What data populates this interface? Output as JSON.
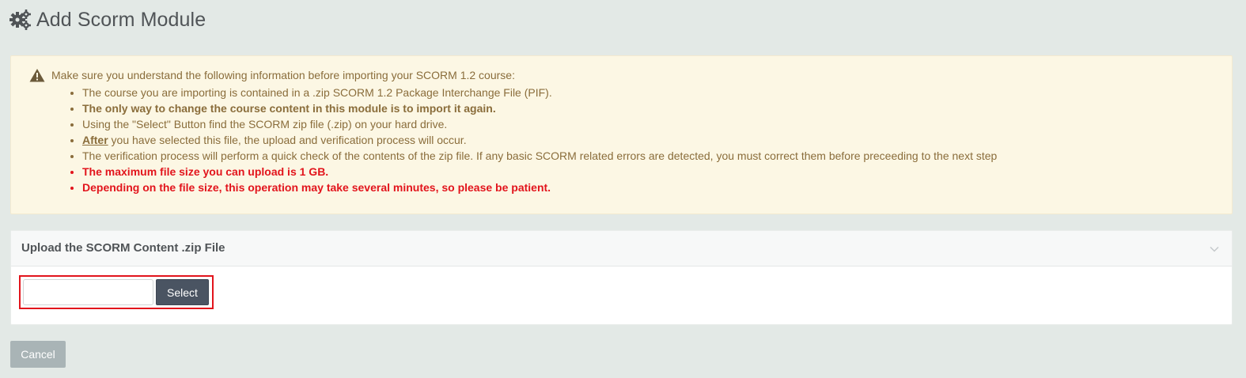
{
  "header": {
    "title": "Add Scorm Module",
    "icon": "gears-icon"
  },
  "warning": {
    "icon": "warning-triangle-icon",
    "intro": "Make sure you understand the following information before importing your SCORM 1.2 course:",
    "items": [
      "The course you are importing is contained in a .zip SCORM 1.2 Package Interchange File (PIF).",
      "The only way to change the course content in this module is to import it again.",
      "Using the \"Select\" Button find the SCORM zip file (.zip) on your hard drive.",
      {
        "prefix": "After",
        "text": " you have selected this file, the upload and verification process will occur."
      },
      "The verification process will perform a quick check of the contents of the zip file. If any basic SCORM related errors are detected, you must correct them before preceeding to the next step",
      "The maximum file size you can upload is 1 GB.",
      "Depending on the file size, this operation may take several minutes, so please be patient."
    ],
    "colors": {
      "text": "#8a6d3b",
      "alert": "#e2141c",
      "background": "#fcf7e4"
    }
  },
  "upload_panel": {
    "title": "Upload the SCORM Content .zip File",
    "collapse_icon": "chevron-down-icon",
    "file_value": "",
    "select_label": "Select"
  },
  "footer": {
    "cancel_label": "Cancel"
  }
}
